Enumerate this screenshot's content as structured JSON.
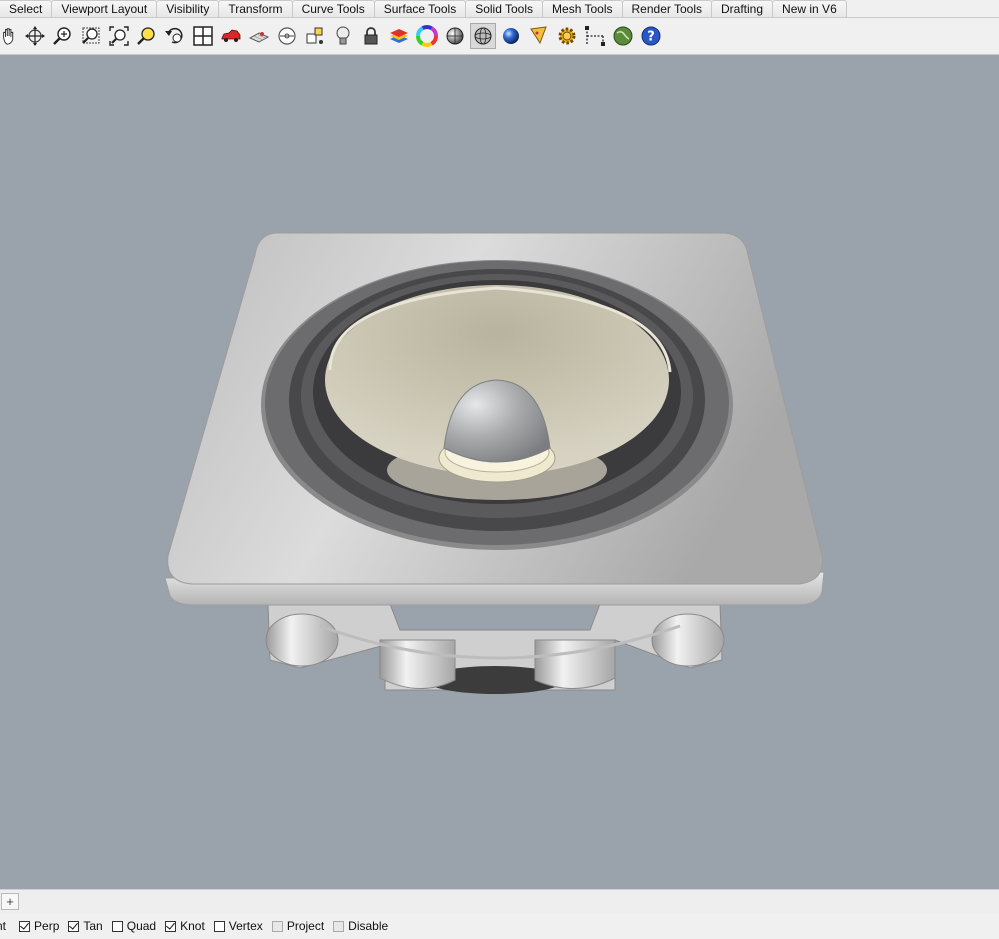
{
  "tabs": [
    "Select",
    "Viewport Layout",
    "Visibility",
    "Transform",
    "Curve Tools",
    "Surface Tools",
    "Solid Tools",
    "Mesh Tools",
    "Render Tools",
    "Drafting",
    "New in V6"
  ],
  "toolbar_icons": [
    "pan-hand-icon",
    "rotate-view-icon",
    "zoom-in-icon",
    "zoom-window-icon",
    "zoom-extents-icon",
    "zoom-selected-icon",
    "undo-view-icon",
    "four-viewports-icon",
    "named-view-car-icon",
    "named-cplane-icon",
    "cplane-icon",
    "snap-points-icon",
    "lightbulb-icon",
    "lock-icon",
    "layers-icon",
    "color-wheel-icon",
    "shaded-sphere-icon",
    "ghosted-sphere-icon",
    "rendered-sphere-icon",
    "display-options-icon",
    "options-gear-icon",
    "dimension-tools-icon",
    "globe-web-icon",
    "help-icon"
  ],
  "command_bar": {
    "add_button": "+"
  },
  "osnap": {
    "truncated_label": "nt",
    "items": [
      {
        "label": "Perp",
        "checked": true,
        "enabled": true
      },
      {
        "label": "Tan",
        "checked": true,
        "enabled": true
      },
      {
        "label": "Quad",
        "checked": false,
        "enabled": true
      },
      {
        "label": "Knot",
        "checked": true,
        "enabled": true
      },
      {
        "label": "Vertex",
        "checked": false,
        "enabled": true
      },
      {
        "label": "Project",
        "checked": false,
        "enabled": false
      },
      {
        "label": "Disable",
        "checked": false,
        "enabled": false
      }
    ]
  },
  "colors": {
    "viewport_background": "#9aa3ab",
    "speaker_plate": "#d5d5d5",
    "surround_rubber": "#4a4a4c",
    "cone": "#c9c4b2",
    "dust_cap": "#a9abad"
  }
}
